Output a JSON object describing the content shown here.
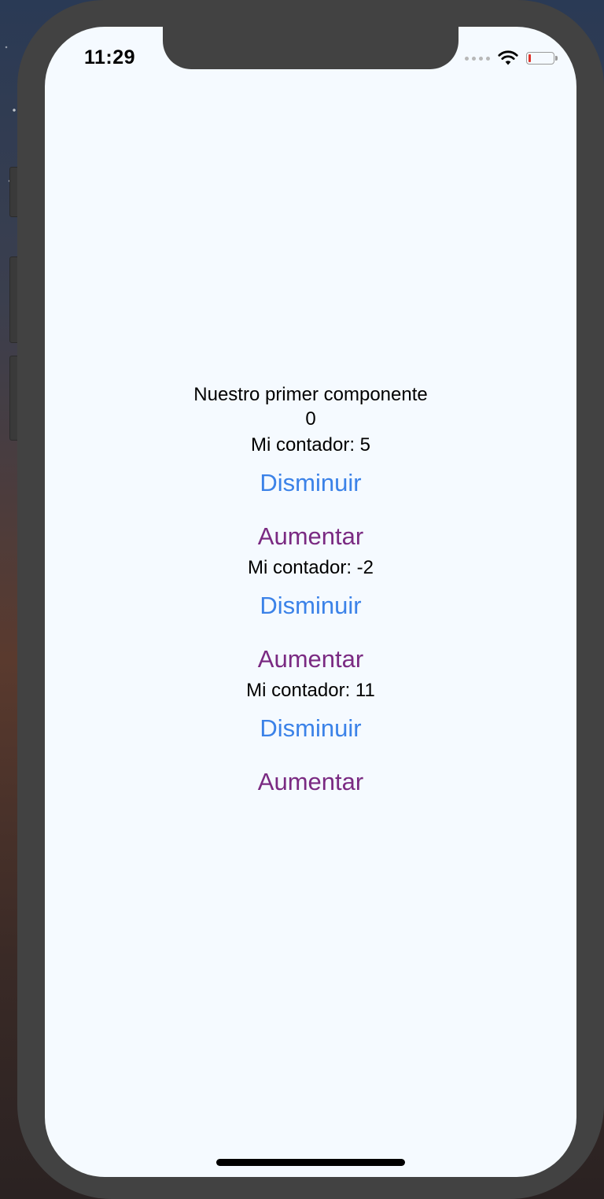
{
  "status_bar": {
    "time": "11:29",
    "signal_icon": "cellular-dots-icon",
    "wifi_icon": "wifi-icon",
    "battery_icon": "battery-low-icon",
    "battery_level": 0.1,
    "battery_color": "#e0332b"
  },
  "main": {
    "title": "Nuestro primer componente",
    "value": "0",
    "counters": [
      {
        "label": "Mi contador: 5",
        "decrease_label": "Disminuir",
        "increase_label": "Aumentar"
      },
      {
        "label": "Mi contador: -2",
        "decrease_label": "Disminuir",
        "increase_label": "Aumentar"
      },
      {
        "label": "Mi contador: 11",
        "decrease_label": "Disminuir",
        "increase_label": "Aumentar"
      }
    ]
  },
  "colors": {
    "decrease": "#3b82e8",
    "increase": "#7a2a82",
    "background": "#f5faff"
  }
}
